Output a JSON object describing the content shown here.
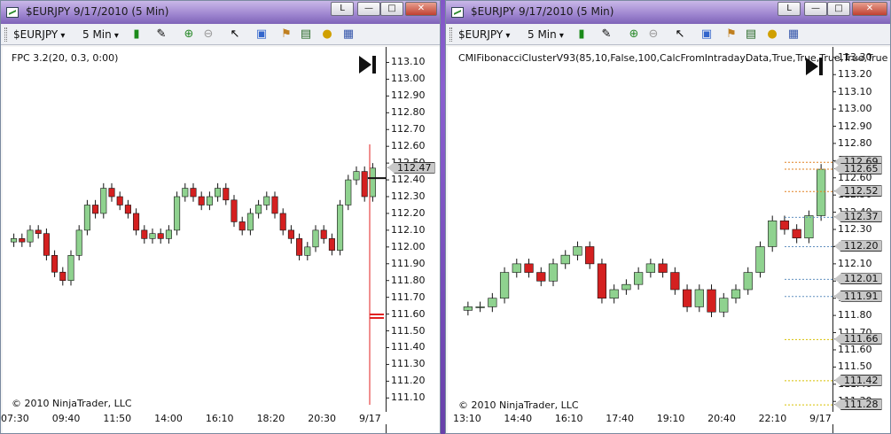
{
  "windows": [
    {
      "title": "$EURJPY  9/17/2010 (5 Min)",
      "window_buttons": [
        "L",
        "—",
        "□",
        "✕"
      ],
      "toolbar": {
        "instrument": "$EURJPY",
        "period": "5 Min"
      },
      "indicator_label": "FPC 3.2(20, 0.3, 0:00)",
      "copyright": "© 2010 NinjaTrader, LLC",
      "y_ticks": [
        "113.10",
        "113.00",
        "112.90",
        "112.80",
        "112.70",
        "112.60",
        "112.50",
        "112.40",
        "112.30",
        "112.20",
        "112.10",
        "112.00",
        "111.90",
        "111.80",
        "111.70",
        "111.60",
        "111.50",
        "111.40",
        "111.30",
        "111.20",
        "111.10"
      ],
      "x_ticks": [
        "07:30",
        "09:40",
        "11:50",
        "14:00",
        "16:10",
        "18:20",
        "20:30",
        "9/17"
      ],
      "price_badges": [
        {
          "label": "112.47",
          "value": 112.47
        }
      ],
      "ymin": 111.07,
      "ymax": 113.15
    },
    {
      "title": "$EURJPY  9/17/2010 (5 Min)",
      "window_buttons": [
        "L",
        "—",
        "□",
        "✕"
      ],
      "toolbar": {
        "instrument": "$EURJPY",
        "period": "5 Min"
      },
      "indicator_label": "CMIFibonacciClusterV93(85,10,False,100,CalcFromIntradayData,True,True,True,True,True,True",
      "copyright": "© 2010 NinjaTrader, LLC",
      "y_ticks": [
        "113.30",
        "113.20",
        "113.10",
        "113.00",
        "112.90",
        "112.80",
        "112.70",
        "112.60",
        "112.50",
        "112.40",
        "112.30",
        "112.20",
        "112.10",
        "112.00",
        "111.90",
        "111.80",
        "111.70",
        "111.60",
        "111.50",
        "111.40",
        "111.30"
      ],
      "x_ticks": [
        "13:10",
        "14:40",
        "16:10",
        "17:40",
        "19:10",
        "20:40",
        "22:10",
        "9/17"
      ],
      "price_badges": [
        {
          "label": "112.69",
          "value": 112.69
        },
        {
          "label": "112.65",
          "value": 112.65
        },
        {
          "label": "112.52",
          "value": 112.52
        },
        {
          "label": "112.37",
          "value": 112.37
        },
        {
          "label": "112.20",
          "value": 112.2
        },
        {
          "label": "112.01",
          "value": 112.01
        },
        {
          "label": "111.91",
          "value": 111.91
        },
        {
          "label": "111.66",
          "value": 111.66
        },
        {
          "label": "111.42",
          "value": 111.42
        },
        {
          "label": "111.28",
          "value": 111.28
        }
      ],
      "ymin": 111.26,
      "ymax": 113.33
    }
  ],
  "colors": {
    "up": "#8fd28f",
    "down": "#d42020",
    "wick": "#111111",
    "chart_bg": "#ffffff",
    "vline": "#e02020"
  },
  "chart_data": [
    {
      "type": "candlestick",
      "x_ticks": [
        "07:30",
        "09:40",
        "11:50",
        "14:00",
        "16:10",
        "18:20",
        "20:30",
        "9/17"
      ],
      "close": [
        112.05,
        112.03,
        112.1,
        112.08,
        111.95,
        111.85,
        111.8,
        111.95,
        112.1,
        112.25,
        112.2,
        112.35,
        112.3,
        112.25,
        112.2,
        112.1,
        112.05,
        112.08,
        112.05,
        112.1,
        112.3,
        112.35,
        112.3,
        112.25,
        112.3,
        112.35,
        112.28,
        112.15,
        112.1,
        112.2,
        112.25,
        112.3,
        112.2,
        112.1,
        112.05,
        111.95,
        112.0,
        112.1,
        112.05,
        111.98,
        112.25,
        112.4,
        112.45,
        112.3,
        112.47
      ]
    },
    {
      "type": "candlestick",
      "x_ticks": [
        "13:10",
        "14:40",
        "16:10",
        "17:40",
        "19:10",
        "20:40",
        "22:10",
        "9/17"
      ],
      "close": [
        111.85,
        111.85,
        111.9,
        112.05,
        112.1,
        112.05,
        112.0,
        112.1,
        112.15,
        112.2,
        112.1,
        111.9,
        111.95,
        111.98,
        112.05,
        112.1,
        112.05,
        111.95,
        111.85,
        111.95,
        111.82,
        111.9,
        111.95,
        112.05,
        112.2,
        112.35,
        112.3,
        112.25,
        112.38,
        112.65
      ]
    }
  ]
}
